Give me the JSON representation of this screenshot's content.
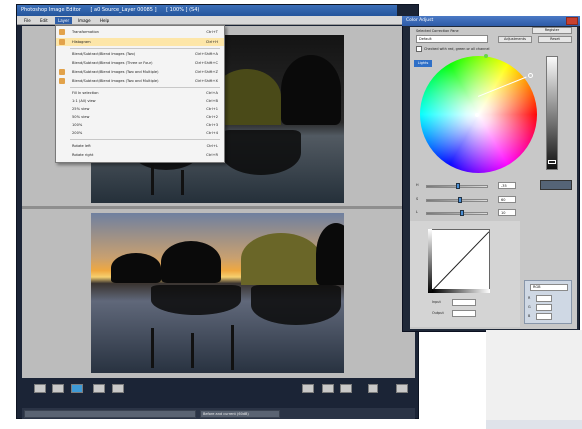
{
  "app": {
    "title_parts": [
      "Photoshop Image Editor",
      "[ a0 Source_Layer 00085 ]",
      "[ 100% ] (S4)"
    ]
  },
  "menubar": {
    "items": [
      "File",
      "Edit",
      "Layer",
      "Image",
      "Help"
    ],
    "active_index": 2
  },
  "dropdown_menu": {
    "items": [
      {
        "label": "Transformation",
        "shortcut": "Ctrl+T",
        "highlighted": false,
        "has_icon": true
      },
      {
        "label": "Histogram",
        "shortcut": "Ctrl+H",
        "highlighted": true,
        "has_icon": true
      },
      {
        "label": "Blend/Subtract/Blend Images (Two)",
        "shortcut": "Ctrl+Shift+A",
        "highlighted": false,
        "has_icon": false
      },
      {
        "label": "Blend/Subtract/Blend Images (Three or Four)",
        "shortcut": "Ctrl+Shift+C",
        "highlighted": false,
        "has_icon": false
      },
      {
        "label": "Blend/Subtract/Blend Images (Two and Multiple)",
        "shortcut": "Ctrl+Shift+Z",
        "highlighted": false,
        "has_icon": true
      },
      {
        "label": "Blend/Subtract/Blend Images (Two and Multiple)",
        "shortcut": "Ctrl+Shift+X",
        "highlighted": false,
        "has_icon": true
      },
      {
        "label": "Fill In selection",
        "shortcut": "Ctrl+A",
        "highlighted": false,
        "has_icon": false
      },
      {
        "label": "1:1 (All) view",
        "shortcut": "Ctrl+B",
        "highlighted": false,
        "has_icon": false
      },
      {
        "label": "25% view",
        "shortcut": "Ctrl+1",
        "highlighted": false,
        "has_icon": false
      },
      {
        "label": "50% view",
        "shortcut": "Ctrl+2",
        "highlighted": false,
        "has_icon": false
      },
      {
        "label": "100%",
        "shortcut": "Ctrl+3",
        "highlighted": false,
        "has_icon": false
      },
      {
        "label": "200%",
        "shortcut": "Ctrl+4",
        "highlighted": false,
        "has_icon": false
      },
      {
        "label": "Rotate left",
        "shortcut": "Ctrl+L",
        "highlighted": false,
        "has_icon": false
      },
      {
        "label": "Rotate right",
        "shortcut": "Ctrl+R",
        "highlighted": false,
        "has_icon": false
      }
    ]
  },
  "status_bar": {
    "field_right": "Before and current (60dB)"
  },
  "color_panel": {
    "title": "Color Adjust",
    "preset_label": "Selected Correction Pane",
    "preset_value": "Default",
    "button_1": "Register",
    "button_2": "Adjustments",
    "button_3": "Reset",
    "tab_label": "Lights",
    "checkbox_label": "Checked with red, green or all channel",
    "slider_labels": [
      "H",
      "S",
      "L"
    ],
    "slider_values": [
      "-35",
      "60",
      "10"
    ],
    "curve_fields": {
      "input_label": "Input",
      "output_label": "Output"
    },
    "mini_panel": {
      "select_value": "RGB",
      "fields": [
        "R",
        "G",
        "B"
      ]
    }
  },
  "colors": {
    "window_frame": "#1b2436",
    "titlebar": "#24559c",
    "menu_highlight": "#fde6a8",
    "accent": "#2e6fc7"
  }
}
